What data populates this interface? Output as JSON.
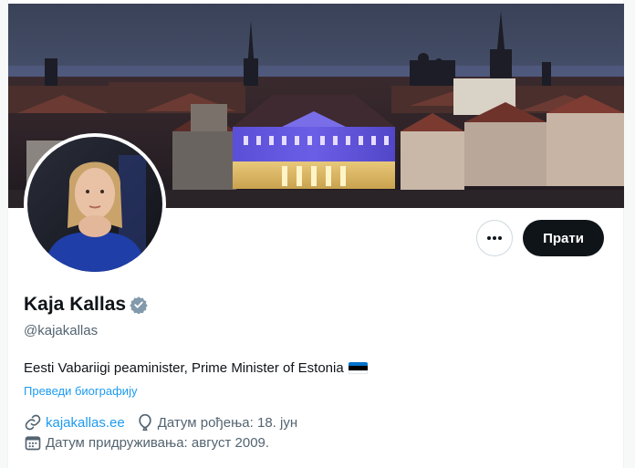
{
  "profile": {
    "name": "Kaja Kallas",
    "handle": "@kajakallas",
    "bio": "Eesti Vabariigi peaminister, Prime Minister of Estonia",
    "translate_label": "Преведи биографију",
    "website": "kajakallas.ee",
    "birthday": "Датум рођења: 18. јун",
    "joined": "Датум придруживања: август 2009."
  },
  "actions": {
    "follow_label": "Прати"
  },
  "icons": {
    "more": "more-icon",
    "verified": "verified-badge-icon",
    "link": "link-icon",
    "birthday": "balloon-icon",
    "joined": "calendar-icon",
    "flag": "estonia-flag-icon"
  },
  "colors": {
    "accent": "#1d9bf0",
    "text_primary": "#0f1419",
    "text_secondary": "#536471",
    "verified": "#829aab",
    "flag": [
      "#0072ce",
      "#000000",
      "#ffffff"
    ]
  }
}
